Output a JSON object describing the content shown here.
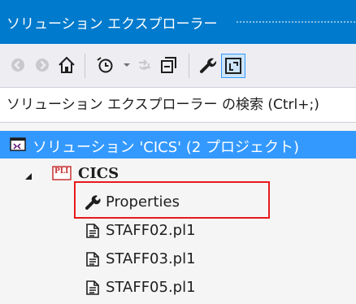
{
  "window": {
    "title": "ソリューション エクスプローラー"
  },
  "toolbar": {
    "buttons": [
      "back-icon",
      "forward-icon",
      "home-icon",
      "pending-changes-icon",
      "dropdown-arrow-icon",
      "refresh-icon",
      "collapse-all-icon",
      "properties-icon",
      "sync-view-icon"
    ]
  },
  "search": {
    "placeholder": "ソリューション エクスプローラー の検索 (Ctrl+;)",
    "value": ""
  },
  "tree": {
    "solution": {
      "label": "ソリューション 'CICS' (2 プロジェクト)",
      "selected": true,
      "icon": "solution-icon"
    },
    "project": {
      "label": "CICS",
      "expanded": true,
      "icon": "pli-project-icon",
      "icon_text": "PLI"
    },
    "items": [
      {
        "label": "Properties",
        "icon": "wrench-icon"
      },
      {
        "label": "STAFF02.pl1",
        "icon": "source-file-icon"
      },
      {
        "label": "STAFF03.pl1",
        "icon": "source-file-icon"
      },
      {
        "label": "STAFF05.pl1",
        "icon": "source-file-icon"
      }
    ]
  },
  "colors": {
    "accent": "#007acc",
    "selection": "#3399ff",
    "highlight_box": "#e8181b"
  }
}
